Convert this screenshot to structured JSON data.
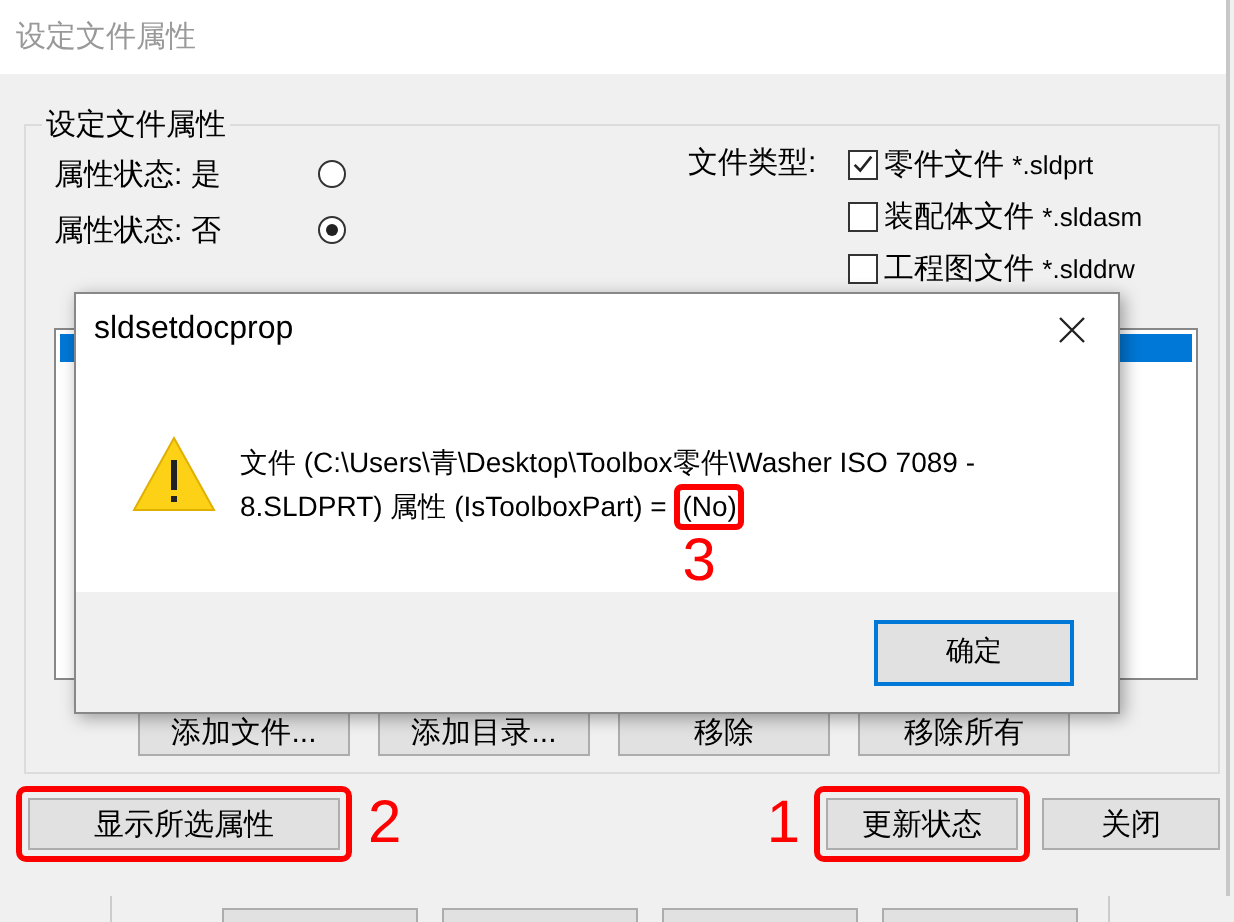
{
  "window": {
    "title": "设定文件属性"
  },
  "group": {
    "title": "设定文件属性",
    "radios": [
      {
        "label": "属性状态: 是",
        "selected": false
      },
      {
        "label": "属性状态: 否",
        "selected": true
      }
    ],
    "file_type_label": "文件类型:",
    "file_types": [
      {
        "name": "零件文件",
        "pattern": "*.sldprt",
        "checked": true
      },
      {
        "name": "装配体文件",
        "pattern": "*.sldasm",
        "checked": false
      },
      {
        "name": "工程图文件",
        "pattern": "*.slddrw",
        "checked": false
      }
    ],
    "list_rows": [
      {
        "selected": true
      }
    ],
    "buttons": [
      "添加文件...",
      "添加目录...",
      "移除",
      "移除所有"
    ]
  },
  "footer_buttons": [
    {
      "label": "显示所选属性",
      "annotation": "2"
    },
    {
      "label": "更新状态",
      "annotation": "1"
    },
    {
      "label": "关闭"
    }
  ],
  "dialog": {
    "title": "sldsetdocprop",
    "message": "文件 (C:\\Users\\青\\Desktop\\Toolbox零件\\Washer ISO 7089 - 8.SLDPRT) 属性 (IsToolboxPart) = ",
    "value": "(No)",
    "value_annotation": "3",
    "ok": "确定"
  }
}
